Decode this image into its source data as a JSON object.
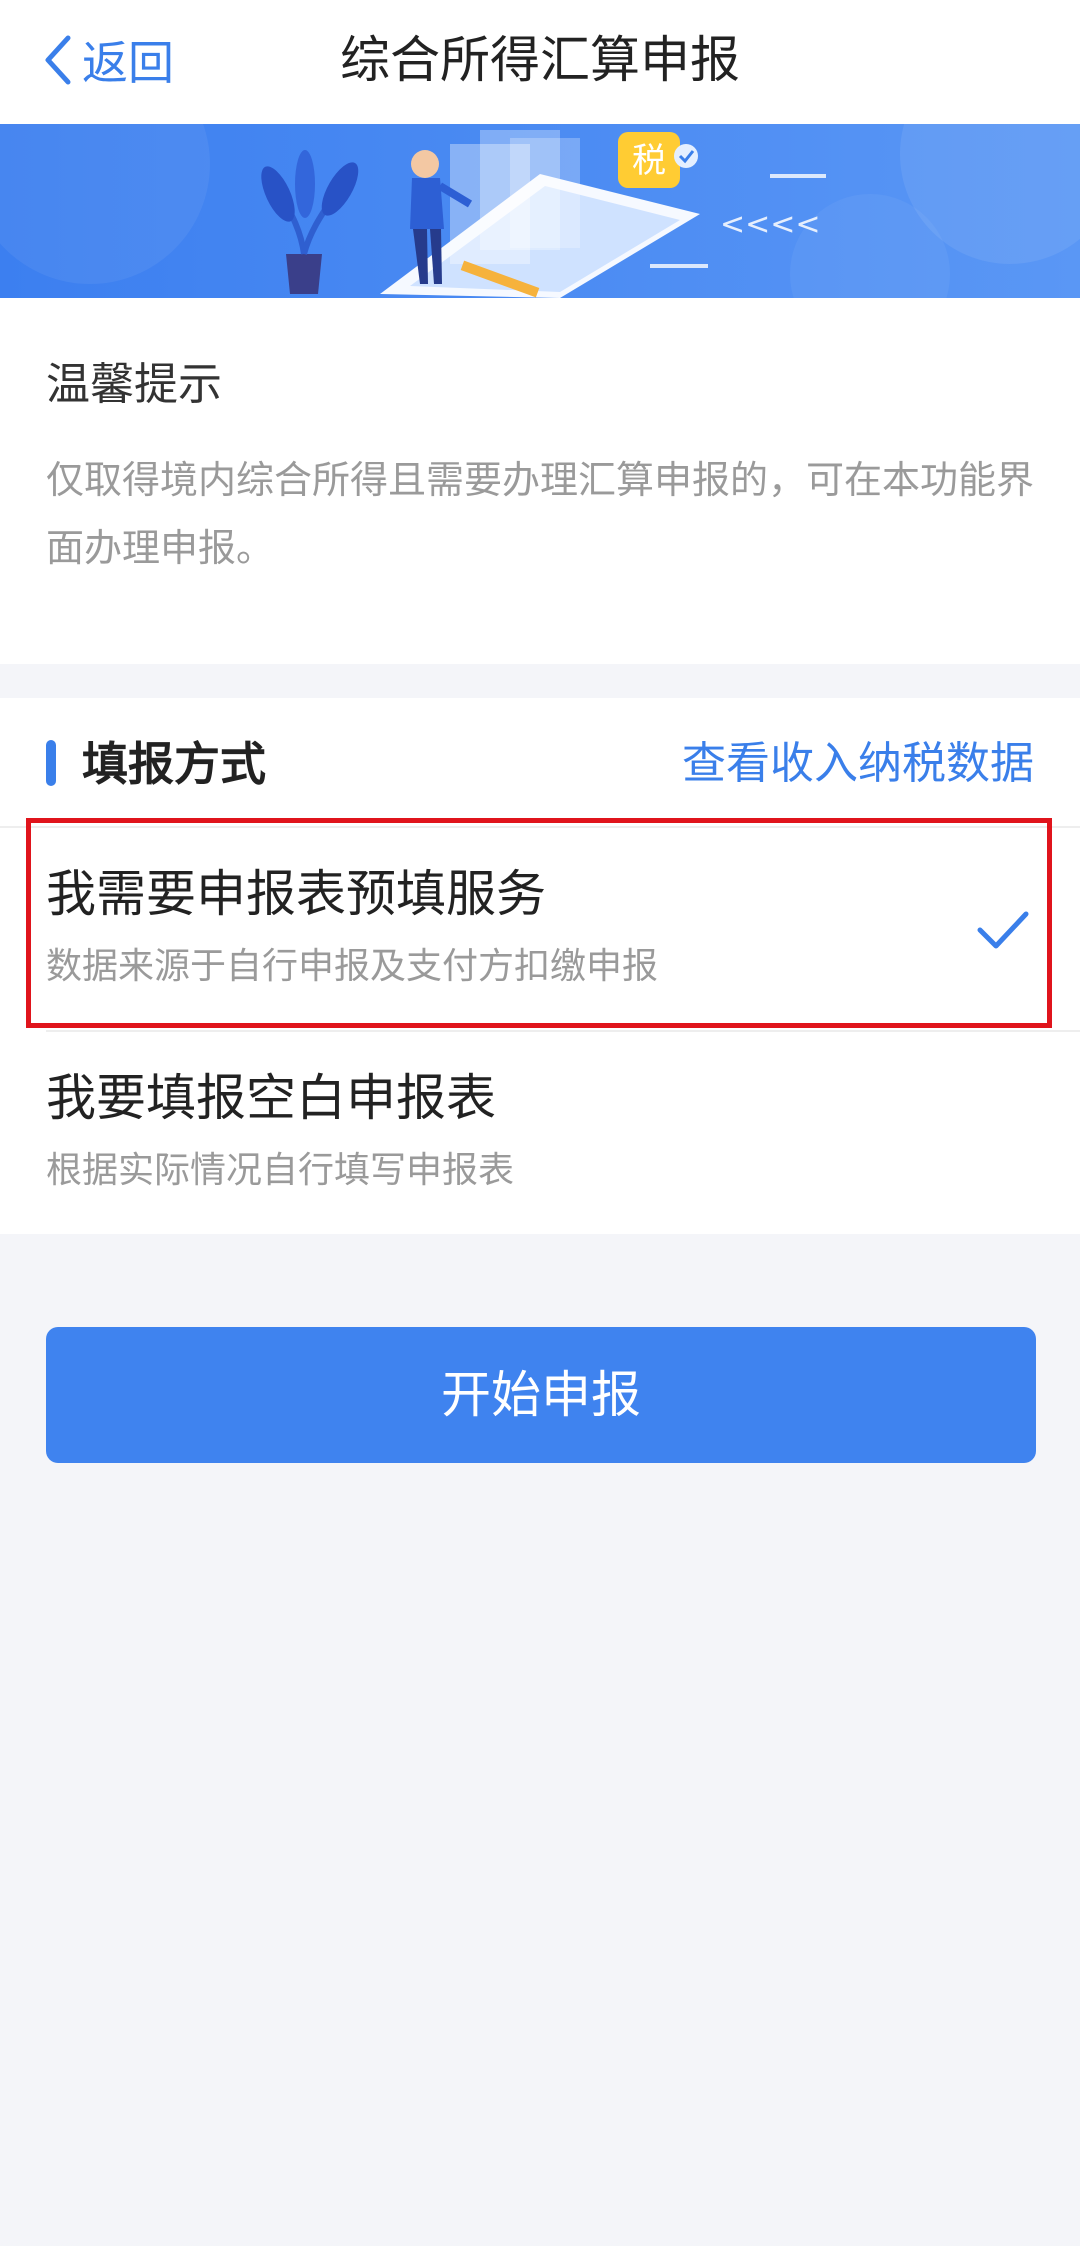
{
  "header": {
    "back_label": "返回",
    "title": "综合所得汇算申报"
  },
  "banner": {
    "tax_badge": "税",
    "arrows": "<<<<"
  },
  "tip": {
    "title": "温馨提示",
    "text": "仅取得境内综合所得且需要办理汇算申报的，可在本功能界面办理申报。"
  },
  "fill_method": {
    "title": "填报方式",
    "link_label": "查看收入纳税数据",
    "options": [
      {
        "label": "我需要申报表预填服务",
        "description": "数据来源于自行申报及支付方扣缴申报",
        "selected": true
      },
      {
        "label": "我要填报空白申报表",
        "description": "根据实际情况自行填写申报表",
        "selected": false
      }
    ]
  },
  "submit": {
    "label": "开始申报"
  },
  "colors": {
    "accent": "#3f83ef",
    "highlight": "#e0141c",
    "background": "#f4f5f9"
  }
}
